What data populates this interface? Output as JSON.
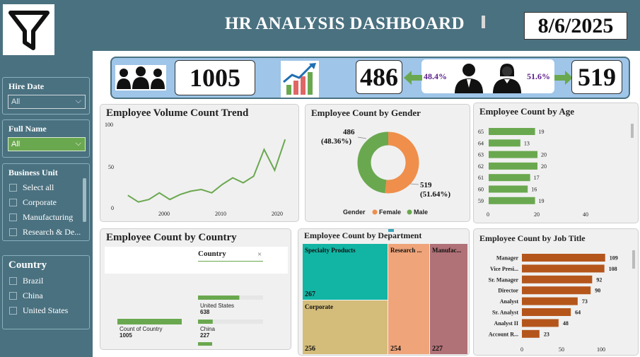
{
  "header": {
    "title": "HR ANALYSIS DASHBOARD",
    "date": "8/6/2025"
  },
  "filters": {
    "hire_date": {
      "label": "Hire Date",
      "value": "All"
    },
    "full_name": {
      "label": "Full Name",
      "value": "All"
    },
    "business_unit": {
      "label": "Business Unit",
      "items": [
        "Select all",
        "Corporate",
        "Manufacturing",
        "Research & De..."
      ]
    },
    "country": {
      "label": "Country",
      "items": [
        "Brazil",
        "China",
        "United States"
      ]
    }
  },
  "kpis": {
    "total_employees": "1005",
    "male_count": "486",
    "female_count": "519",
    "male_pct": "48.4%",
    "female_pct": "51.6%"
  },
  "colors": {
    "green": "#6aa84f",
    "orange": "#ef8f4b",
    "rust": "#b4561c",
    "teal": "#1abc9c",
    "header": "#4a7180"
  },
  "charts": {
    "volume_trend": {
      "title": "Employee Volume Count Trend",
      "y_ticks": [
        "100",
        "50",
        "0"
      ],
      "x_ticks": [
        "2000",
        "2010",
        "2020"
      ]
    },
    "gender": {
      "title": "Employee Count by Gender",
      "male_label": "486",
      "male_pct_label": "(48.36%)",
      "female_label": "519",
      "female_pct_label": "(51.64%)",
      "legend_title": "Gender",
      "legend_female": "Female",
      "legend_male": "Male"
    },
    "age": {
      "title": "Employee Count by Age",
      "x_ticks": [
        "0",
        "20",
        "40"
      ]
    },
    "country": {
      "title": "Employee Count by Country",
      "filter_label": "Country",
      "count_label": "Count of Country",
      "count_value": "1005",
      "bar1_label": "United States",
      "bar1_value": "638",
      "bar2_label": "China",
      "bar2_value": "227"
    },
    "department": {
      "title": "Employee Count by Department",
      "tiles": [
        {
          "name": "Specialty Products",
          "value": "267"
        },
        {
          "name": "Corporate",
          "value": "256"
        },
        {
          "name": "Research ...",
          "value": "254"
        },
        {
          "name": "Manufac...",
          "value": "227"
        }
      ]
    },
    "job_title": {
      "title": "Employee Count by Job Title",
      "x_ticks": [
        "0",
        "50",
        "100"
      ]
    }
  },
  "chart_data": [
    {
      "type": "line",
      "title": "Employee Volume Count Trend",
      "x": [
        1992,
        1994,
        1996,
        1998,
        2000,
        2002,
        2004,
        2006,
        2008,
        2010,
        2012,
        2014,
        2016,
        2018,
        2020,
        2022
      ],
      "y": [
        15,
        7,
        10,
        18,
        10,
        16,
        20,
        22,
        18,
        28,
        36,
        30,
        38,
        70,
        45,
        82
      ],
      "ylim": [
        0,
        100
      ]
    },
    {
      "type": "pie",
      "title": "Employee Count by Gender",
      "labels": [
        "Female",
        "Male"
      ],
      "values": [
        519,
        486
      ]
    },
    {
      "type": "bar",
      "title": "Employee Count by Age",
      "categories": [
        "65",
        "64",
        "63",
        "62",
        "61",
        "60",
        "59"
      ],
      "values": [
        19,
        13,
        20,
        20,
        17,
        16,
        19
      ]
    },
    {
      "type": "bar",
      "title": "Employee Count by Job Title",
      "categories": [
        "Manager",
        "Vice Presi...",
        "Sr. Manager",
        "Director",
        "Analyst",
        "Sr. Analyst",
        "Analyst II",
        "Account R..."
      ],
      "values": [
        109,
        108,
        92,
        90,
        73,
        64,
        48,
        23
      ]
    },
    {
      "type": "bar",
      "title": "Employee Count by Country",
      "categories": [
        "United States",
        "China"
      ],
      "values": [
        638,
        227
      ]
    }
  ]
}
